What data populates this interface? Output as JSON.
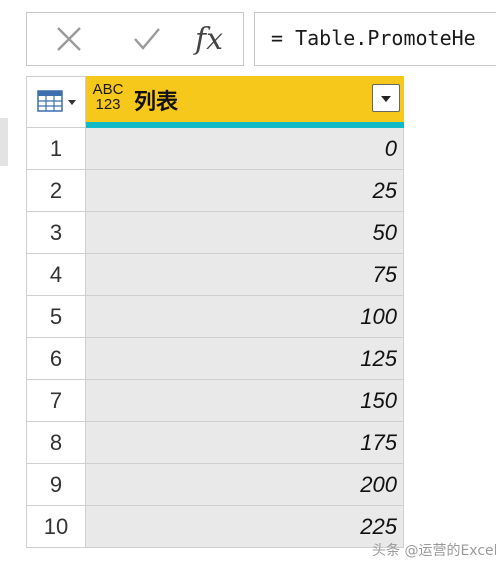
{
  "formula_bar": {
    "fx_label": "fx",
    "formula": "= Table.PromoteHe"
  },
  "table": {
    "column": {
      "type_top": "ABC",
      "type_bottom": "123",
      "name": "列表"
    },
    "rows": [
      {
        "num": "1",
        "value": "0"
      },
      {
        "num": "2",
        "value": "25"
      },
      {
        "num": "3",
        "value": "50"
      },
      {
        "num": "4",
        "value": "75"
      },
      {
        "num": "5",
        "value": "100"
      },
      {
        "num": "6",
        "value": "125"
      },
      {
        "num": "7",
        "value": "150"
      },
      {
        "num": "8",
        "value": "175"
      },
      {
        "num": "9",
        "value": "200"
      },
      {
        "num": "10",
        "value": "225"
      }
    ]
  },
  "watermark": "头条 @运营的Excel",
  "colors": {
    "header_bg": "#f7c81c",
    "header_bar": "#13b9c7",
    "cell_bg": "#e9e9e9"
  }
}
